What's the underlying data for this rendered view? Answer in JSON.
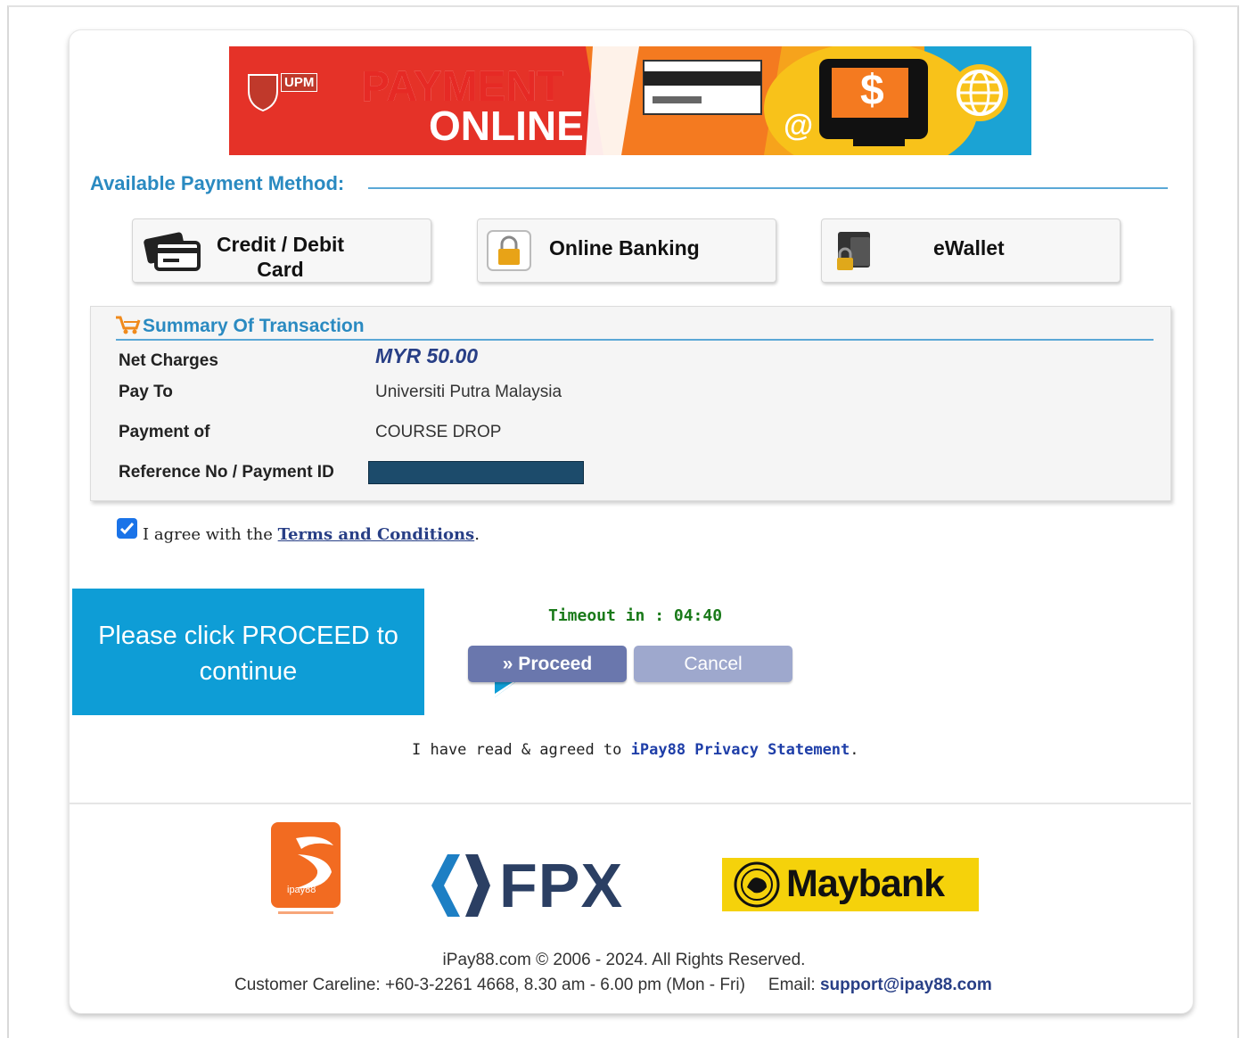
{
  "banner": {
    "line1": "PAYMENT",
    "line2": "ONLINE",
    "logo_text": "UPM",
    "at_symbol": "@",
    "dollar_symbol": "$"
  },
  "payment_methods": {
    "title": "Available Payment Method:",
    "items": [
      {
        "label": "Credit / Debit Card",
        "icon": "credit-card-icon"
      },
      {
        "label": "Online Banking",
        "icon": "lock-icon"
      },
      {
        "label": "eWallet",
        "icon": "wallet-icon"
      }
    ]
  },
  "summary": {
    "title": "Summary Of Transaction",
    "rows": [
      {
        "label": "Net Charges",
        "value": "MYR 50.00"
      },
      {
        "label": "Pay To",
        "value": "Universiti Putra Malaysia"
      },
      {
        "label": "Payment of",
        "value": "COURSE DROP"
      },
      {
        "label": "Reference No / Payment ID",
        "value": ""
      }
    ]
  },
  "agree": {
    "checked": true,
    "prefix": "I agree with the ",
    "link": "Terms and Conditions",
    "suffix": "."
  },
  "callout": {
    "text_line1": "Please click PROCEED to",
    "text_line2": "continue"
  },
  "timeout": {
    "text": "Timeout in : 04:40"
  },
  "actions": {
    "proceed_label": "» Proceed",
    "cancel_label": "Cancel"
  },
  "privacy": {
    "prefix": "I have read & agreed to ",
    "link": "iPay88 Privacy Statement",
    "suffix": "."
  },
  "logos": {
    "ipay88": "ipay88",
    "fpx": "FPX",
    "maybank": "Maybank"
  },
  "footer": {
    "copyright": "iPay88.com © 2006 - 2024. All Rights Reserved.",
    "careline": "Customer Careline: +60-3-2261 4668, 8.30 am - 6.00 pm (Mon - Fri)",
    "email_label": "Email: ",
    "email": "support@ipay88.com"
  },
  "colors": {
    "accent_blue": "#2a8ac1",
    "proceed": "#6a77ad",
    "cancel": "#9ea8cd",
    "callout": "#0e9dd6",
    "timeout_green": "#1a7a1a",
    "maybank_yellow": "#f5d20b"
  }
}
